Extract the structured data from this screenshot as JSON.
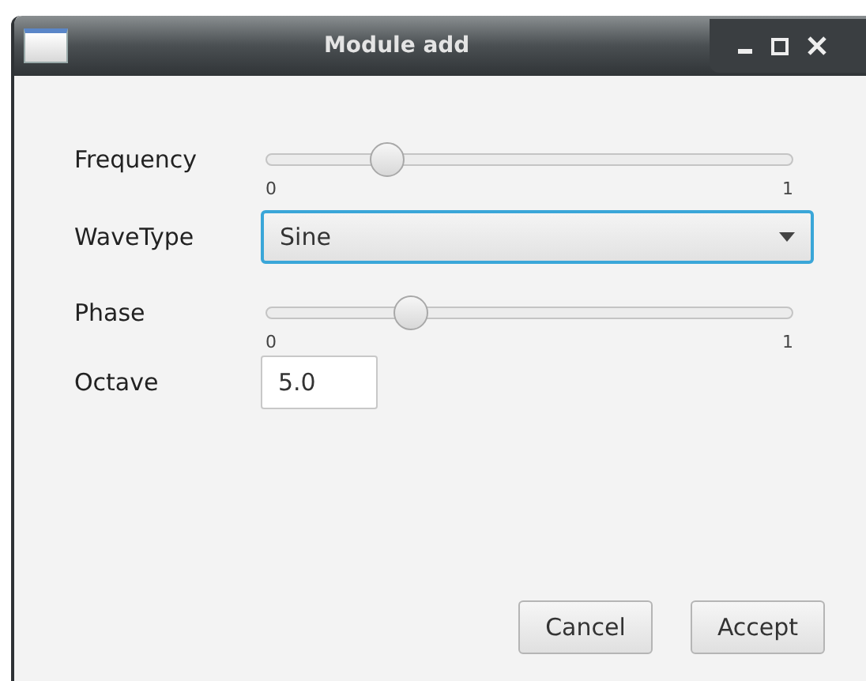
{
  "window": {
    "title": "Module add"
  },
  "fields": [
    {
      "kind": "slider",
      "label": "Frequency",
      "level": 0.21,
      "min_label": "0",
      "max_label": "1"
    },
    {
      "kind": "dropdown",
      "label": "WaveType",
      "value": "Sine",
      "focused": true
    },
    {
      "kind": "slider",
      "label": "Phase",
      "level": 0.26,
      "min_label": "0",
      "max_label": "1"
    },
    {
      "kind": "text",
      "label": "Octave",
      "value": "5.0"
    }
  ],
  "buttons": [
    "Cancel",
    "Accept"
  ]
}
